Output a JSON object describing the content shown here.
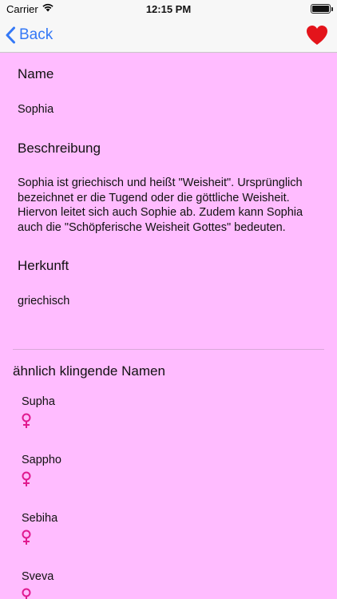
{
  "status_bar": {
    "carrier": "Carrier",
    "time": "12:15 PM"
  },
  "nav": {
    "back_label": "Back",
    "favorite_icon": "heart-icon",
    "accent": "#3478f6",
    "heart_color": "#e4141b"
  },
  "detail": {
    "name_heading": "Name",
    "name_value": "Sophia",
    "description_heading": "Beschreibung",
    "description_value": "Sophia ist griechisch und heißt \"Weisheit\". Ursprünglich bezeichnet er die Tugend oder die göttliche Weisheit. Hiervon leitet sich auch Sophie ab. Zudem kann Sophia auch die \"Schöpferische Weisheit Gottes\" bedeuten.",
    "origin_heading": "Herkunft",
    "origin_value": "griechisch"
  },
  "similar": {
    "heading": "ähnlich klingende Namen",
    "gender_icon": "female-symbol-icon",
    "gender_color": "#e0198f",
    "items": [
      {
        "name": "Supha"
      },
      {
        "name": "Sappho"
      },
      {
        "name": "Sebiha"
      },
      {
        "name": "Sveva"
      }
    ]
  },
  "colors": {
    "background": "#ffbcff"
  }
}
